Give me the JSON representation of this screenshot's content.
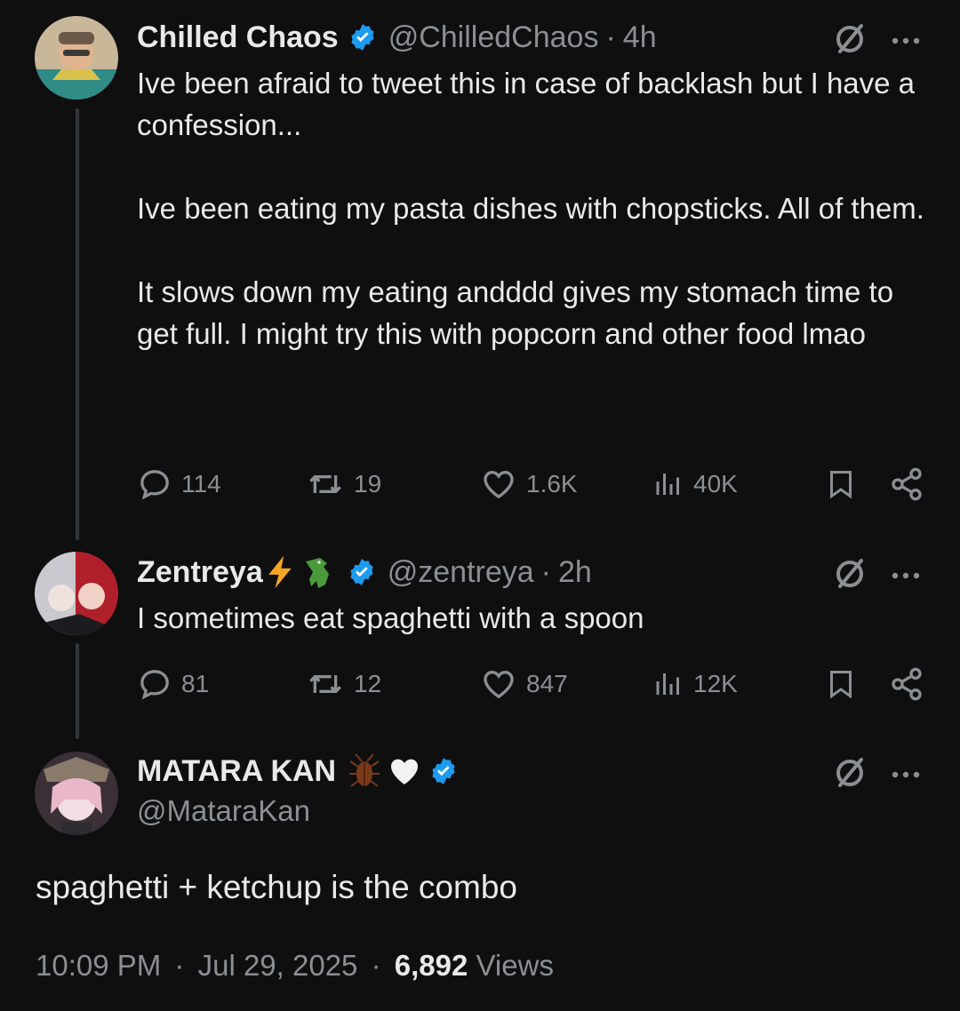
{
  "tweets": [
    {
      "name": "Chilled Chaos",
      "handle": "@ChilledChaos",
      "separator": "·",
      "time": "4h",
      "text": [
        "Ive been afraid to tweet this in case of backlash but I have a confession...",
        "Ive been eating my pasta dishes with chopsticks. All of them.",
        "It slows down my eating andddd gives my stomach time to get full. I might try this with popcorn and other food lmao"
      ],
      "replies": "114",
      "reposts": "19",
      "likes": "1.6K",
      "views": "40K"
    },
    {
      "name": "Zentreya",
      "handle": "@zentreya",
      "separator": "·",
      "time": "2h",
      "text": [
        "I sometimes eat spaghetti with a spoon"
      ],
      "replies": "81",
      "reposts": "12",
      "likes": "847",
      "views": "12K"
    }
  ],
  "main_tweet": {
    "name": "MATARA KAN",
    "handle": "@MataraKan",
    "text": "spaghetti + ketchup is the combo",
    "time": "10:09 PM",
    "date": "Jul 29, 2025",
    "views_count": "6,892",
    "views_label": "Views",
    "separator": "·"
  },
  "colors": {
    "background": "#0f0f10",
    "verified": "#1d9bf0",
    "text": "#e7e9ea",
    "secondary": "#8b8f94"
  }
}
